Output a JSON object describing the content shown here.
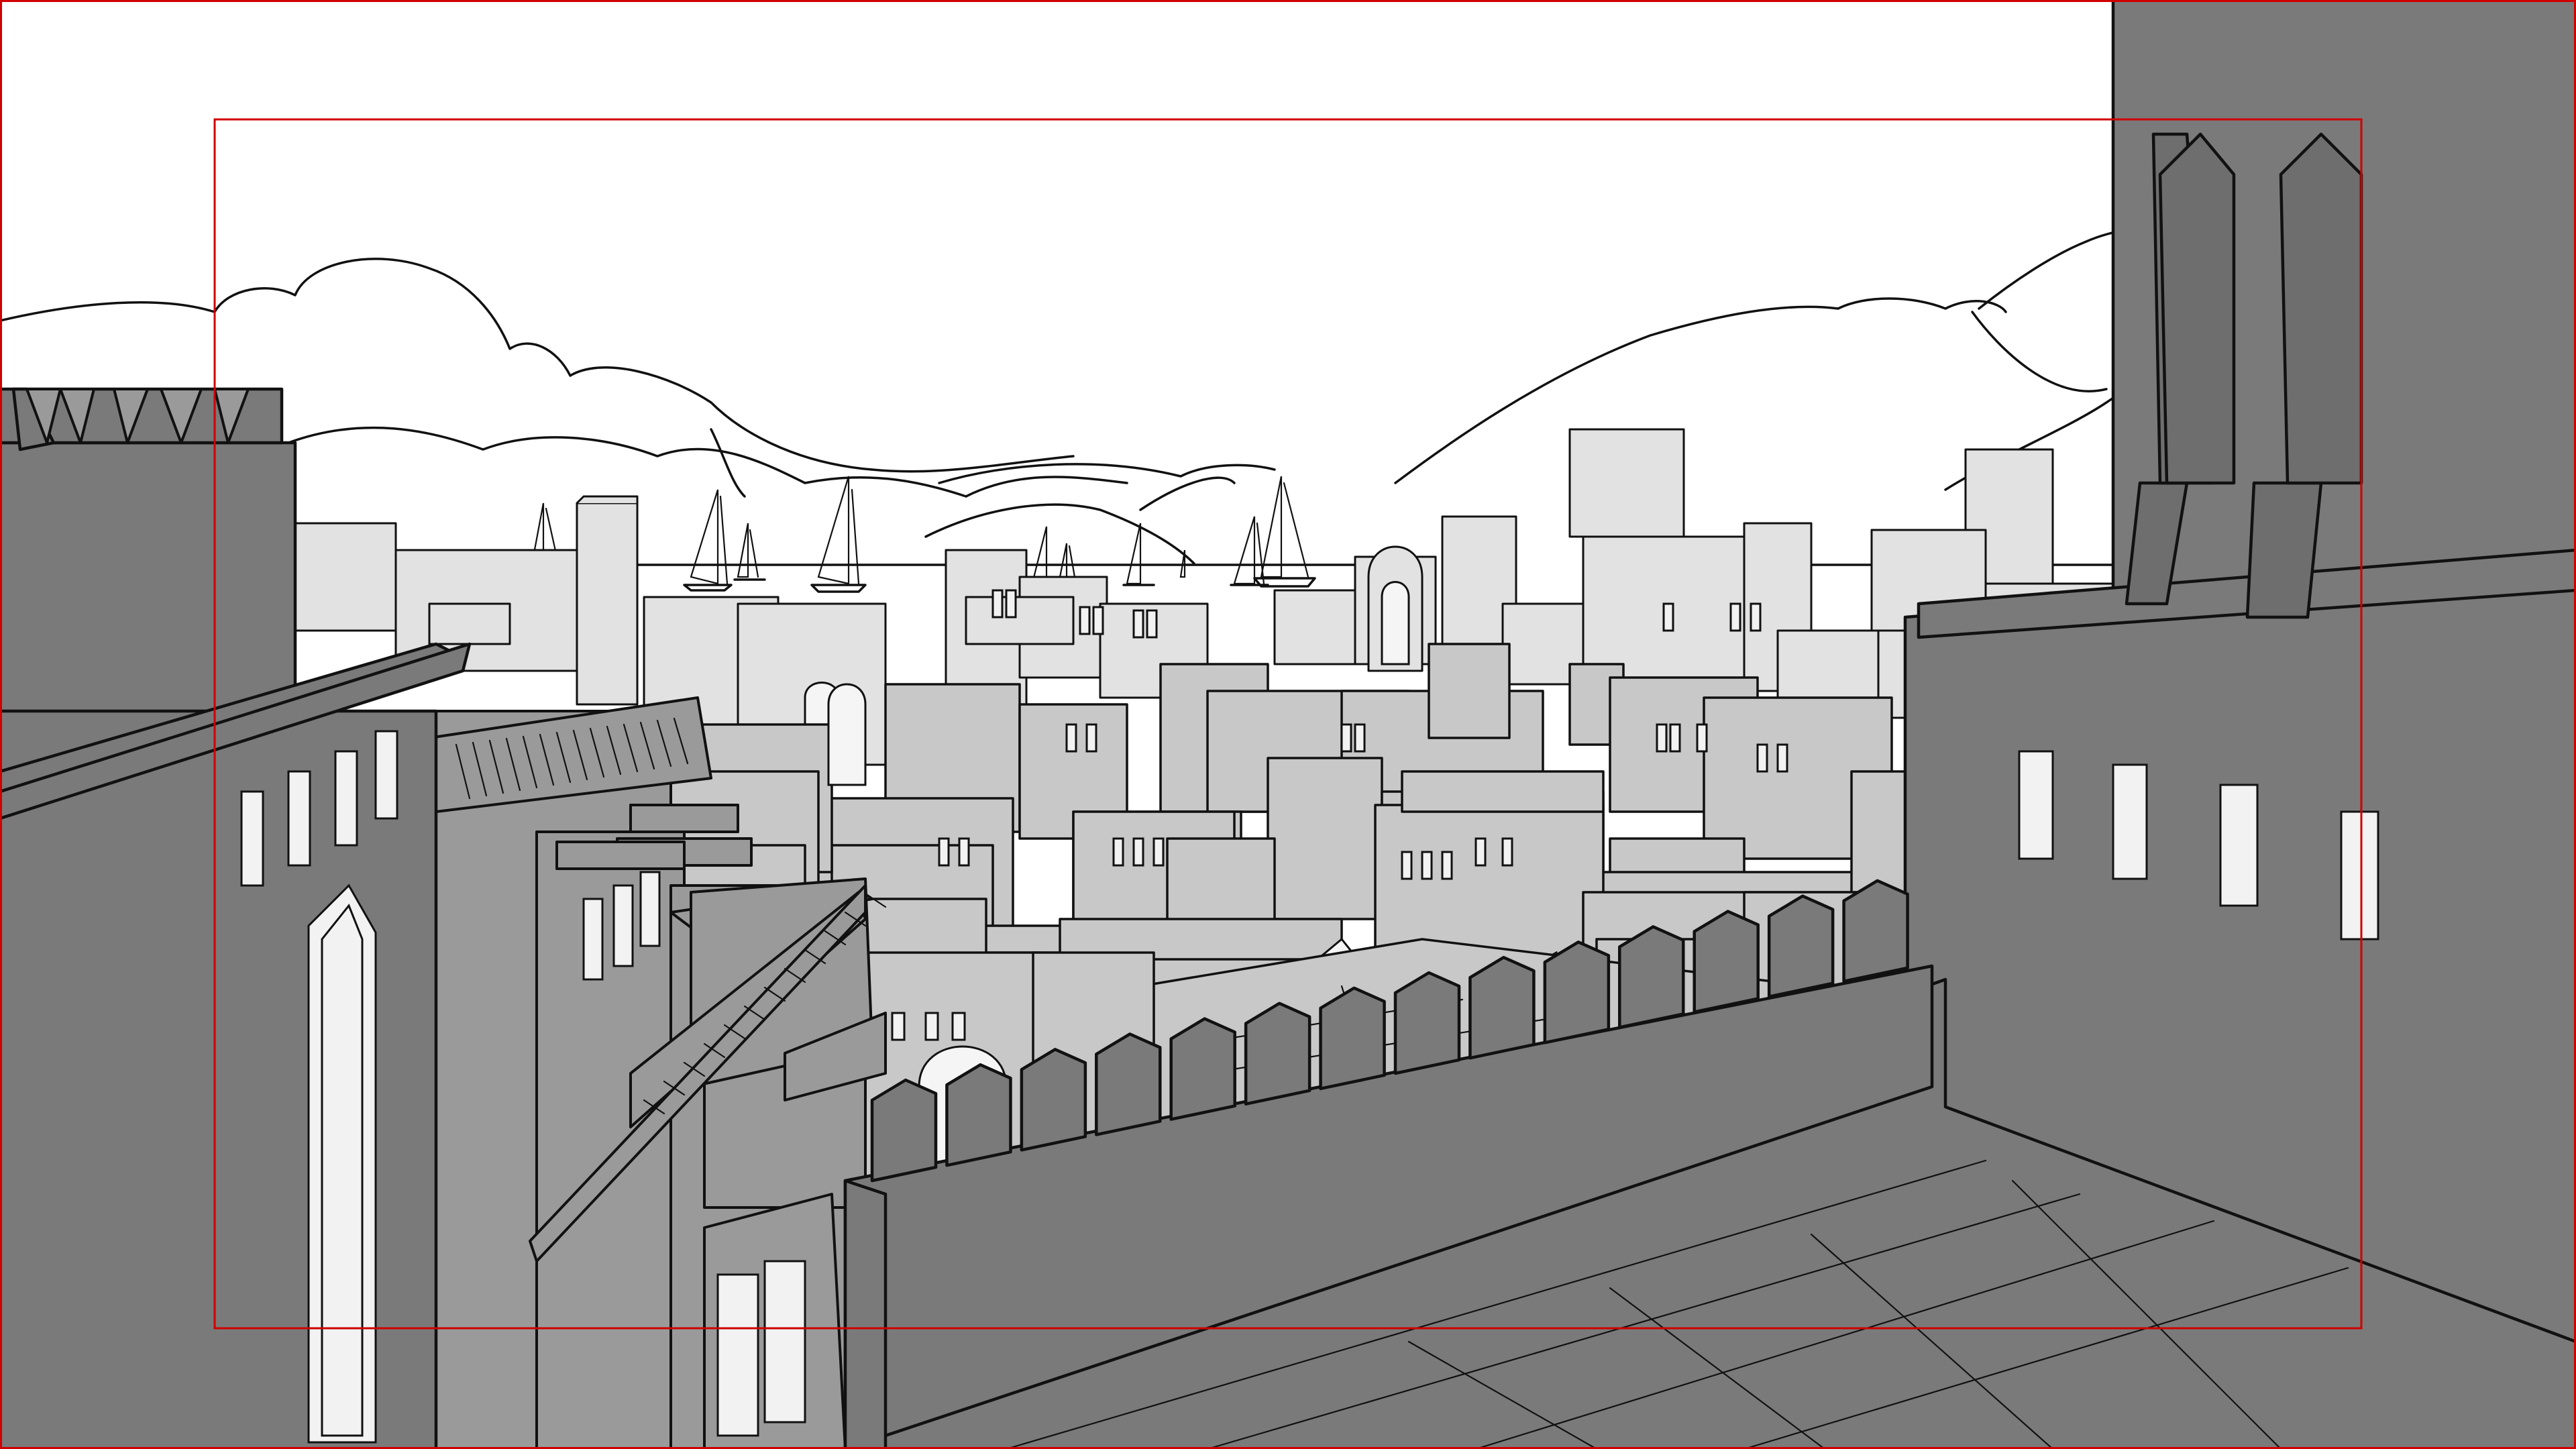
{
  "scene": {
    "kind": "storyboard-background-sketch",
    "colors": {
      "sky": "#ffffff",
      "far_buildings": "#e2e2e2",
      "mid_buildings": "#c8c8c8",
      "near_buildings": "#9a9a9a",
      "foreground_tower": "#7a7a7a",
      "ink": "#111111",
      "frame_guides": "#d00000"
    }
  }
}
